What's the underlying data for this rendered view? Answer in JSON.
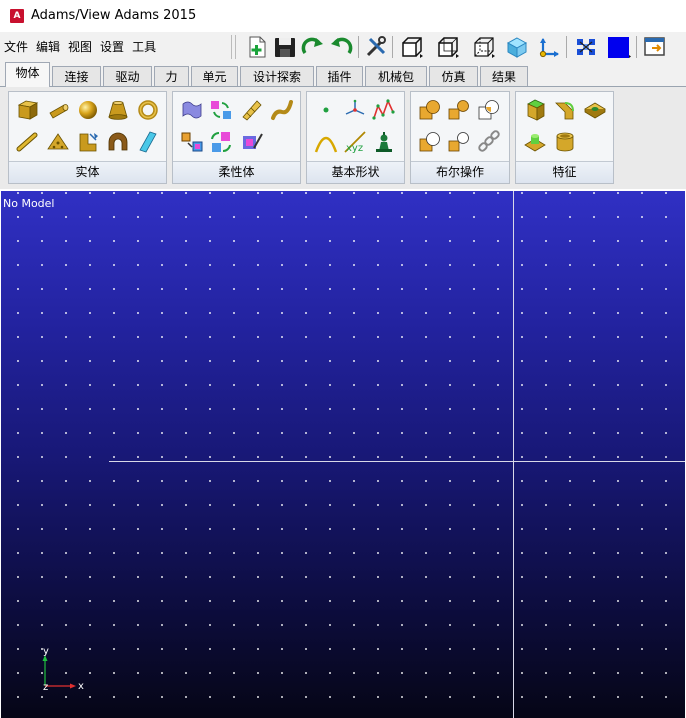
{
  "window": {
    "title": "Adams/View Adams 2015",
    "logo_letter": "A"
  },
  "menu": [
    "文件",
    "编辑",
    "视图",
    "设置",
    "工具"
  ],
  "toolbar_icons": [
    "new-model-icon",
    "save-icon",
    "redo-icon",
    "undo-icon",
    "tools-icon",
    "view-front-icon",
    "view-top-icon",
    "view-iso-icon",
    "render-shaded-icon",
    "coordinate-system-icon",
    "select-group-icon",
    "color-icon",
    "window-icon"
  ],
  "tabs": [
    {
      "label": "物体",
      "active": true
    },
    {
      "label": "连接"
    },
    {
      "label": "驱动"
    },
    {
      "label": "力"
    },
    {
      "label": "单元"
    },
    {
      "label": "设计探索"
    },
    {
      "label": "插件"
    },
    {
      "label": "机械包"
    },
    {
      "label": "仿真"
    },
    {
      "label": "结果"
    }
  ],
  "ribbon_groups": [
    {
      "label": "实体",
      "icons": [
        "box-icon",
        "cylinder-icon",
        "sphere-icon",
        "frustum-icon",
        "torus-icon",
        "link-icon",
        "plate-icon",
        "extrusion-icon",
        "revolution-icon",
        "plane-icon"
      ]
    },
    {
      "label": "柔性体",
      "icons": [
        "flex-body-icon",
        "flex-convert-icon",
        "flex-beam-icon",
        "flex-connector-icon",
        "flex-import-icon",
        "flex-swap-icon",
        "flex-material-icon"
      ]
    },
    {
      "label": "基本形状",
      "icons": [
        "point-icon",
        "marker-icon",
        "polyline-icon",
        "arc-icon",
        "spline-icon",
        "mass-icon"
      ]
    },
    {
      "label": "布尔操作",
      "icons": [
        "union-icon",
        "merge-icon",
        "intersect-icon",
        "cut-icon",
        "split-icon",
        "chain-icon"
      ]
    },
    {
      "label": "特征",
      "icons": [
        "chamfer-icon",
        "fillet-icon",
        "hole-icon",
        "boss-icon",
        "shell-icon"
      ]
    }
  ],
  "viewport": {
    "label": "No Model",
    "triad": {
      "x": "x",
      "y": "y",
      "z": "z"
    },
    "bg_top": "#3030c4",
    "bg_bottom": "#060616"
  }
}
